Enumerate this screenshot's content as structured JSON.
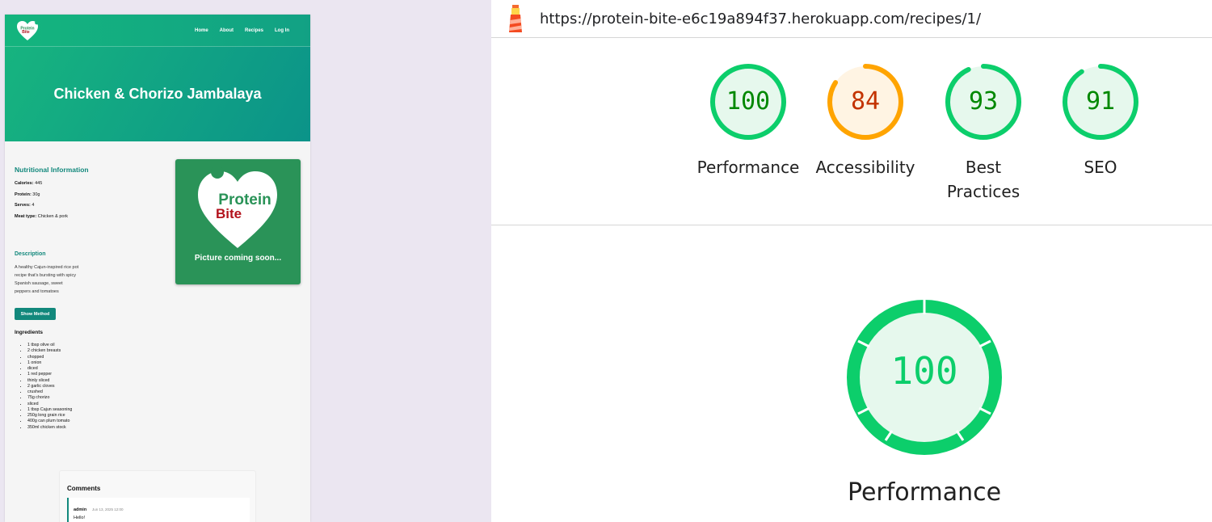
{
  "site": {
    "logo_text_1": "Protein",
    "logo_text_2": "Bite",
    "nav": [
      "Home",
      "About",
      "Recipes",
      "Log In"
    ],
    "recipe_title": "Chicken & Chorizo Jambalaya",
    "nutrition_title": "Nutritional Information",
    "nutrition": [
      {
        "key": "Calories:",
        "value": " 445"
      },
      {
        "key": "Protein:",
        "value": " 30g"
      },
      {
        "key": "Serves:",
        "value": " 4"
      },
      {
        "key": "Meat type:",
        "value": " Chicken & pork"
      }
    ],
    "description_title": "Description",
    "description": "A healthy Cajun-inspired rice pot recipe that's bursting with spicy Spanish sausage, sweet peppers and tomatoes",
    "show_method": "Show Method",
    "ingredients_title": "Ingredients",
    "ingredients": [
      "1 tbsp olive oil",
      "2 chicken breasts",
      "chopped",
      "1 onion",
      "diced",
      "1 red pepper",
      "thinly sliced",
      "2 garlic cloves",
      "crushed",
      "75g chorizo",
      "sliced",
      "1 tbsp Cajun seasoning",
      "250g long grain rice",
      "400g can plum tomato",
      "350ml chicken stock"
    ],
    "image_caption": "Picture coming soon...",
    "comments_title": "Comments",
    "comment": {
      "user": "admin",
      "date": "Jun 13, 2025 12:00",
      "text": "Hello!"
    },
    "colors": {
      "brand": "#12887c",
      "image_bg": "#2a9358",
      "logo_green": "#2a9358",
      "logo_red": "#b3121c"
    }
  },
  "lighthouse": {
    "url": "https://protein-bite-e6c19a894f37.herokuapp.com/recipes/1/",
    "scores": [
      {
        "label": "Performance",
        "score": "100",
        "value": 100,
        "color": "#0cce6b",
        "text_color": "#008800",
        "bg": "#e6f8ed"
      },
      {
        "label": "Accessibility",
        "score": "84",
        "value": 84,
        "color": "#ffa400",
        "text_color": "#c33300",
        "bg": "#fff4e3"
      },
      {
        "label": "Best\nPractices",
        "label_line1": "Best",
        "label_line2": "Practices",
        "score": "93",
        "value": 93,
        "color": "#0cce6b",
        "text_color": "#008800",
        "bg": "#e6f8ed"
      },
      {
        "label": "SEO",
        "score": "91",
        "value": 91,
        "color": "#0cce6b",
        "text_color": "#008800",
        "bg": "#e6f8ed"
      }
    ],
    "main": {
      "score": "100",
      "label": "Performance"
    },
    "icon": "lighthouse-icon"
  }
}
